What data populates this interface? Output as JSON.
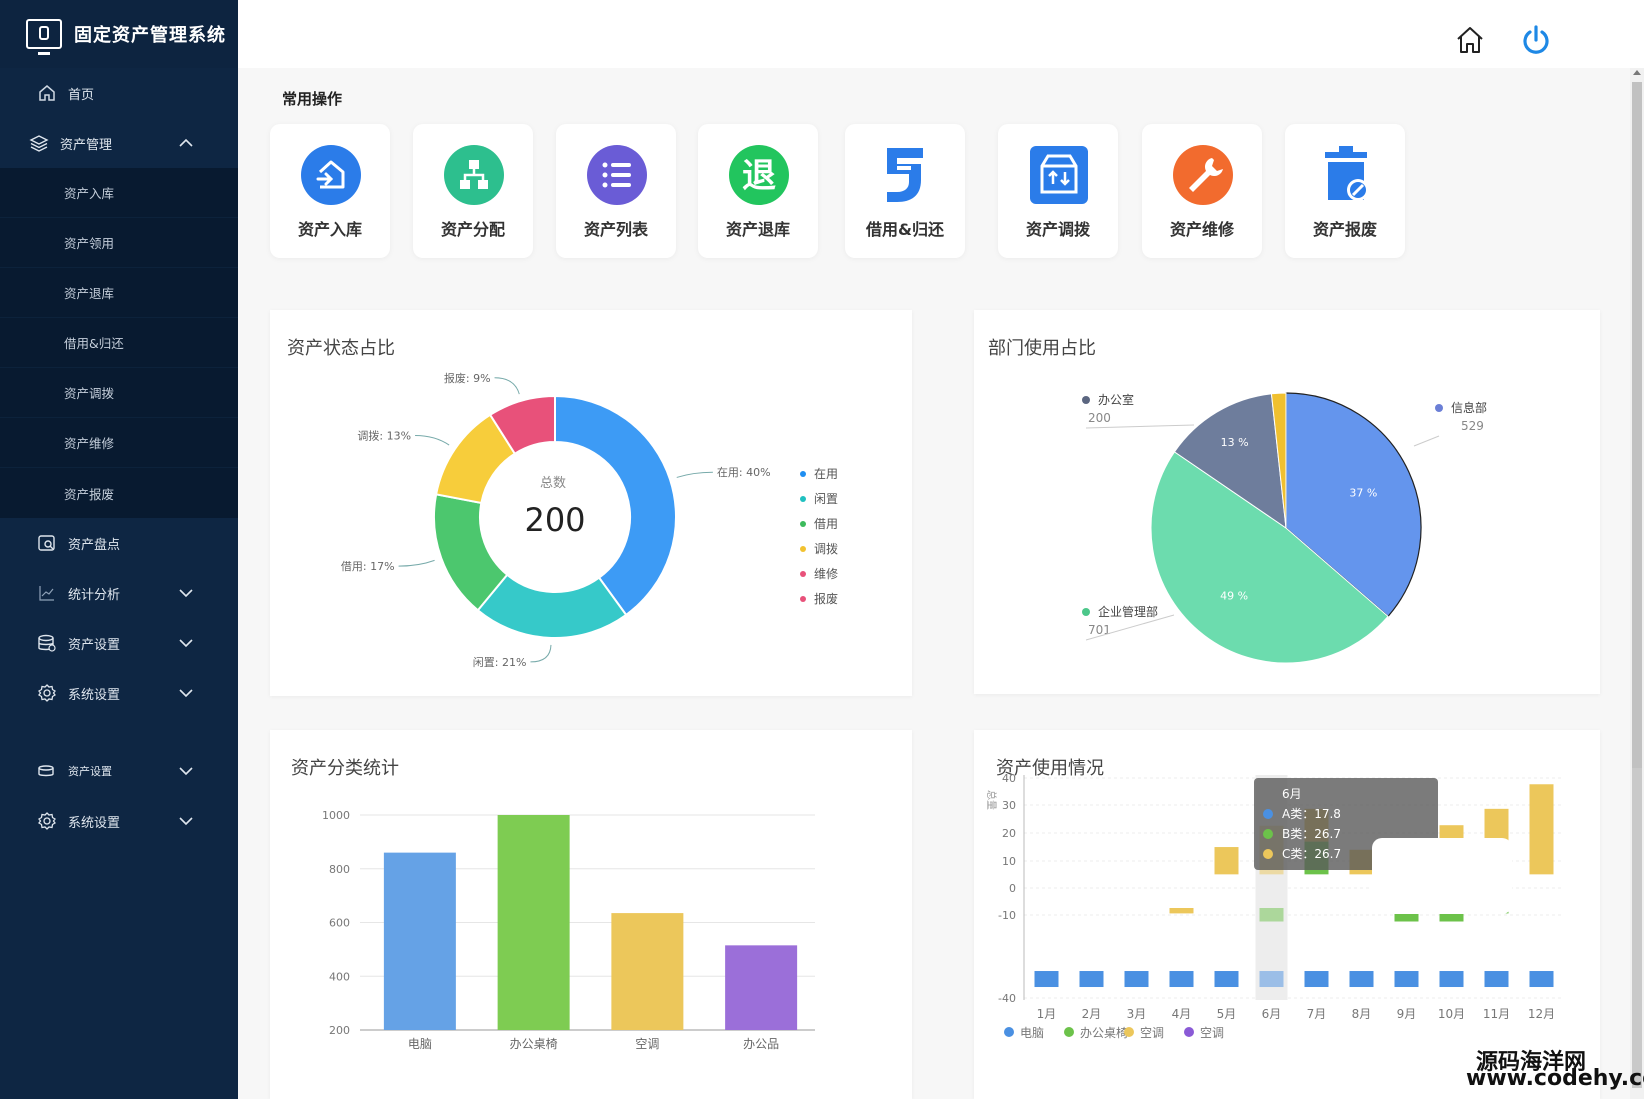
{
  "app": {
    "title": "固定资产管理系统"
  },
  "sidebar": {
    "home": "首页",
    "asset_mgmt": "资产管理",
    "sub_items": [
      "资产入库",
      "资产领用",
      "资产退库",
      "借用&归还",
      "资产调拨",
      "资产维修",
      "资产报废"
    ],
    "inventory": "资产盘点",
    "stats": "统计分析",
    "asset_settings": "资产设置",
    "system_settings": "系统设置",
    "asset_settings_2": "资产设置",
    "system_settings_2": "系统设置"
  },
  "ops": {
    "title": "常用操作",
    "items": [
      {
        "label": "资产入库",
        "icon": "asset-in-icon",
        "color": "#2b7ce9"
      },
      {
        "label": "资产分配",
        "icon": "asset-allocate-icon",
        "color": "#2dbf8e"
      },
      {
        "label": "资产列表",
        "icon": "asset-list-icon",
        "color": "#6a5cd6"
      },
      {
        "label": "资产退库",
        "icon": "asset-return-icon",
        "color": "#22c55e",
        "glyph": "退"
      },
      {
        "label": "借用&归还",
        "icon": "borrow-return-icon",
        "color": "#2b7ce9"
      },
      {
        "label": "资产调拨",
        "icon": "asset-transfer-icon",
        "color": "#2b7ce9"
      },
      {
        "label": "资产维修",
        "icon": "asset-repair-icon",
        "color": "#f26b2e"
      },
      {
        "label": "资产报废",
        "icon": "asset-scrap-icon",
        "color": "#2b7ce9"
      }
    ]
  },
  "panels": {
    "status_title": "资产状态占比",
    "dept_title": "部门使用占比",
    "category_title": "资产分类统计",
    "usage_title": "资产使用情况"
  },
  "status_center": {
    "label": "总数",
    "value": "200"
  },
  "tooltip": {
    "title": "6月",
    "rows": [
      "A类：17.8",
      "B类：26.7",
      "C类：26.7"
    ]
  },
  "watermark": {
    "line1": "源码海洋网",
    "line2": "www.codehy.com"
  },
  "chart_data": [
    {
      "type": "pie",
      "title": "资产状态占比",
      "categories": [
        "在用",
        "闲置",
        "借用",
        "调拨",
        "维修",
        "报废"
      ],
      "values": [
        40,
        21,
        17,
        13,
        0,
        9
      ],
      "labels": [
        "在用: 40%",
        "闲置: 21%",
        "借用: 17%",
        "调拨: 13%",
        "报废: 9%"
      ],
      "colors": [
        "#3d9bf5",
        "#36c9c9",
        "#4cc76e",
        "#f7cd3b",
        "#e8517a",
        "#e8517a"
      ]
    },
    {
      "type": "pie",
      "title": "部门使用占比",
      "categories": [
        "信息部",
        "企业管理部",
        "办公室",
        ""
      ],
      "values": [
        529,
        701,
        200,
        25
      ],
      "percent_labels": [
        "37 %",
        "49 %",
        "13 %",
        ""
      ],
      "colors": [
        "#6495ed",
        "#6cdcae",
        "#6e7d9c",
        "#f0c030"
      ]
    },
    {
      "type": "bar",
      "title": "资产分类统计",
      "categories": [
        "电脑",
        "办公桌椅",
        "空调",
        "办公品"
      ],
      "values": [
        860,
        1000,
        635,
        515
      ],
      "ylim": [
        200,
        1000
      ],
      "yticks": [
        "200",
        "400",
        "600",
        "800",
        "1000"
      ],
      "colors": [
        "#65a2e6",
        "#7ecc52",
        "#ecc75b",
        "#9b6fd9"
      ]
    },
    {
      "type": "bar",
      "title": "资产使用情况",
      "ylabel": "总量",
      "categories": [
        "1月",
        "2月",
        "3月",
        "4月",
        "5月",
        "6月",
        "7月",
        "8月",
        "9月",
        "10月",
        "11月",
        "12月"
      ],
      "yticks": [
        "-40",
        "-10",
        "0",
        "10",
        "20",
        "30",
        "40"
      ],
      "series": [
        {
          "name": "电脑",
          "values": [
            -36,
            -36,
            -36,
            -36,
            -36,
            -36,
            -36,
            -36,
            -36,
            -36,
            -36,
            -36
          ]
        },
        {
          "name": "办公桌椅",
          "values": [
            0,
            0,
            0,
            0,
            0,
            -5,
            12,
            0,
            -5,
            -5,
            -2,
            0
          ]
        },
        {
          "name": "空调",
          "values": [
            0,
            0,
            0,
            -2,
            10,
            17.8,
            12,
            9,
            12,
            18,
            24,
            33
          ]
        },
        {
          "name": "空调",
          "values": [
            0,
            0,
            0,
            0,
            0,
            0,
            0,
            0,
            0,
            0,
            0,
            0
          ]
        }
      ],
      "colors": [
        "#4a90e2",
        "#6cc24a",
        "#ecc75b",
        "#8a5ad6"
      ]
    }
  ]
}
